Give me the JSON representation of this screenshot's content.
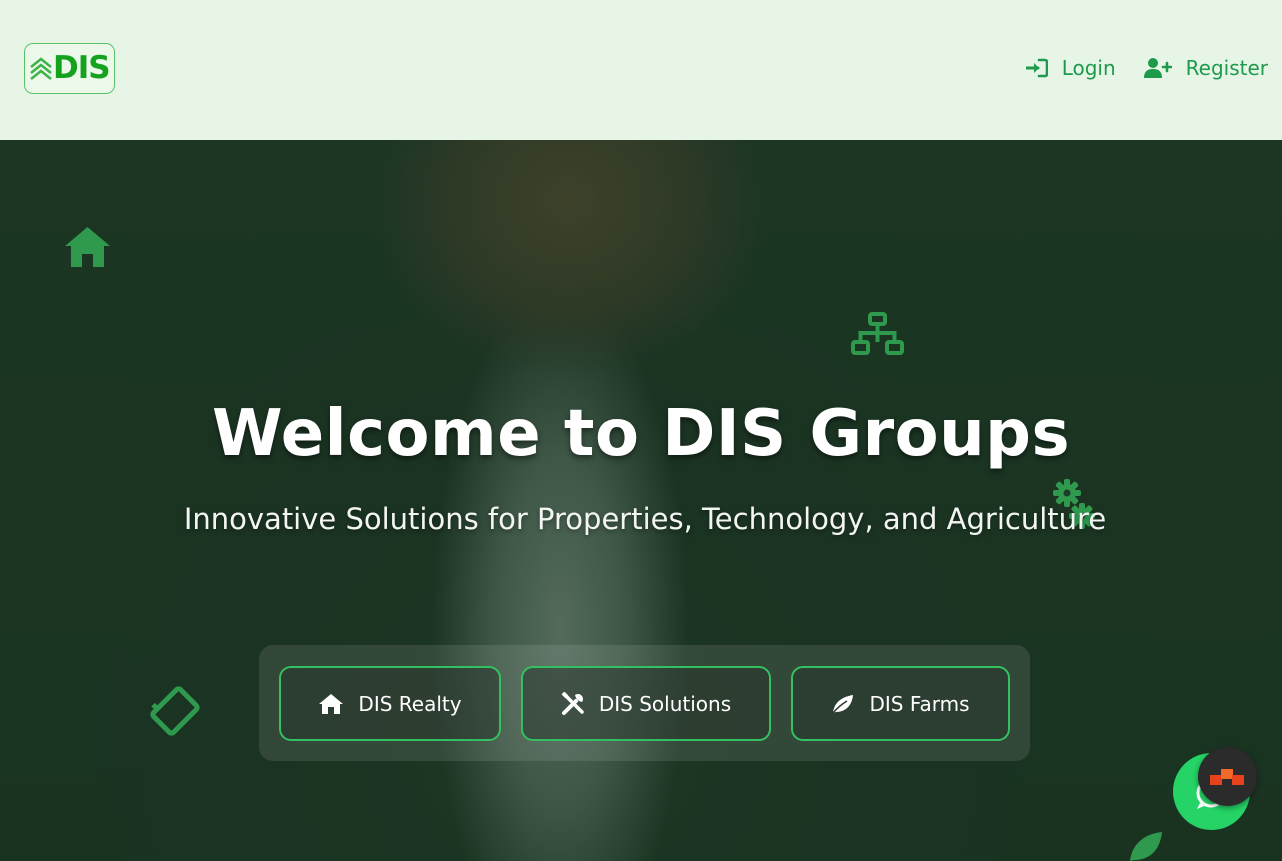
{
  "header": {
    "logo_text": "DIS",
    "nav": [
      {
        "label": "Login",
        "icon": "sign-in-icon"
      },
      {
        "label": "Register",
        "icon": "user-plus-icon"
      }
    ]
  },
  "hero": {
    "title": "Welcome to DIS Groups",
    "subtitle": "Innovative Solutions for Properties, Technology, and Agriculture",
    "buttons": [
      {
        "label": "DIS Realty",
        "icon": "home-icon"
      },
      {
        "label": "DIS Solutions",
        "icon": "tools-icon"
      },
      {
        "label": "DIS Farms",
        "icon": "leaf-icon"
      }
    ],
    "decorative_icons": [
      "home-icon",
      "network-icon",
      "gears-icon",
      "tag-icon",
      "leaf-icon"
    ]
  },
  "floating": {
    "whatsapp_icon": "whatsapp-icon",
    "chat_icon": "chat-widget-icon"
  },
  "colors": {
    "brand_green": "#15a21f",
    "nav_green": "#1e9a4c",
    "header_bg": "#e7f5e7",
    "button_border": "#34c060",
    "whatsapp_green": "#25d366"
  }
}
